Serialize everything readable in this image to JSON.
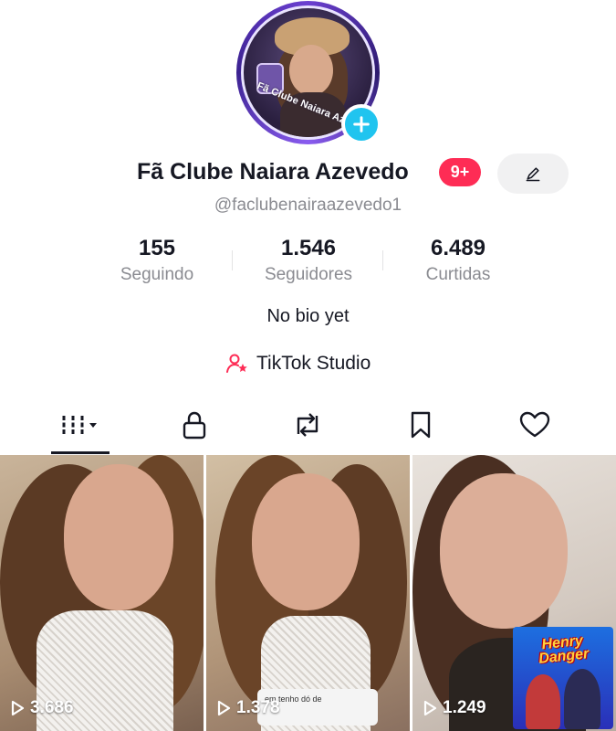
{
  "profile": {
    "display_name": "Fã Clube Naiara Azevedo",
    "notification_badge": "9+",
    "username": "@faclubenairaazevedo1",
    "avatar_caption": "Fã Clube Naiara Azevedo",
    "bio": "No bio yet"
  },
  "stats": [
    {
      "value": "155",
      "label": "Seguindo"
    },
    {
      "value": "1.546",
      "label": "Seguidores"
    },
    {
      "value": "6.489",
      "label": "Curtidas"
    }
  ],
  "studio": {
    "label": "TikTok Studio",
    "icon": "person-star-icon"
  },
  "tabs": [
    {
      "icon": "videos-grid-icon",
      "selected": true
    },
    {
      "icon": "lock-icon",
      "selected": false
    },
    {
      "icon": "repost-icon",
      "selected": false
    },
    {
      "icon": "bookmark-icon",
      "selected": false
    },
    {
      "icon": "heart-icon",
      "selected": false
    }
  ],
  "videos": [
    {
      "views": "3.686"
    },
    {
      "views": "1.378",
      "caption": "em tenho dó de"
    },
    {
      "views": "1.249",
      "overlay_title": "Henry Danger"
    }
  ],
  "colors": {
    "accent_red": "#fe2c55",
    "add_button": "#20c4ef",
    "text_primary": "#161823",
    "text_secondary": "#8a8b91"
  }
}
